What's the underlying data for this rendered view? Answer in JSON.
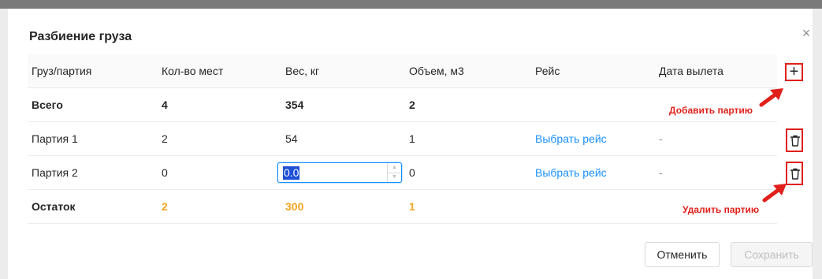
{
  "dialog": {
    "title": "Разбиение груза",
    "close_glyph": "×"
  },
  "table": {
    "headers": [
      "Груз/партия",
      "Кол-во мест",
      "Вес, кг",
      "Объем, м3",
      "Рейс",
      "Дата вылета"
    ],
    "total": {
      "label": "Всего",
      "places": "4",
      "weight": "354",
      "volume": "2"
    },
    "rows": [
      {
        "label": "Партия 1",
        "places": "2",
        "weight": "54",
        "volume": "1",
        "flight": "Выбрать рейс",
        "date": "-"
      },
      {
        "label": "Партия 2",
        "places": "0",
        "weight_input": "0.0",
        "volume": "0",
        "flight": "Выбрать рейс",
        "date": "-"
      }
    ],
    "remainder": {
      "label": "Остаток",
      "places": "2",
      "weight": "300",
      "volume": "1"
    }
  },
  "actions": {
    "add_glyph": "+",
    "add_annotation": "Добавить партию",
    "delete_annotation": "Удалить партию"
  },
  "footer": {
    "cancel_label": "Отменить",
    "save_label": "Сохранить"
  },
  "colors": {
    "accent": "#1890ff",
    "warning": "#f5a623",
    "annotation": "#e0201b"
  },
  "icons": [
    "close-icon",
    "plus-icon",
    "trash-icon",
    "arrow-icon"
  ]
}
